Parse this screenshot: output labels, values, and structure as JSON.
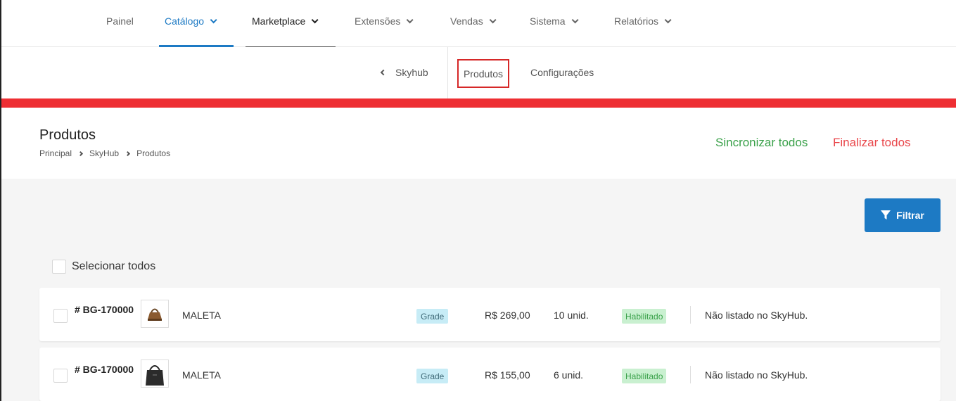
{
  "topnav": {
    "items": [
      {
        "label": "Painel"
      },
      {
        "label": "Catálogo"
      },
      {
        "label": "Marketplace"
      },
      {
        "label": "Extensões"
      },
      {
        "label": "Vendas"
      },
      {
        "label": "Sistema"
      },
      {
        "label": "Relatórios"
      }
    ]
  },
  "subnav": {
    "back_label": "Skyhub",
    "tabs": [
      {
        "label": "Produtos"
      },
      {
        "label": "Configurações"
      }
    ]
  },
  "header": {
    "title": "Produtos",
    "breadcrumb": [
      "Principal",
      "SkyHub",
      "Produtos"
    ],
    "sync_all": "Sincronizar todos",
    "finish_all": "Finalizar todos"
  },
  "toolbar": {
    "filter_label": "Filtrar",
    "select_all_label": "Selecionar todos"
  },
  "products": [
    {
      "sku": "# BG-170000",
      "name": "MALETA",
      "type": "Grade",
      "price": "R$ 269,00",
      "stock": "10 unid.",
      "status": "Habilitado",
      "listing": "Não listado no SkyHub."
    },
    {
      "sku": "# BG-170000",
      "name": "MALETA",
      "type": "Grade",
      "price": "R$ 155,00",
      "stock": "6 unid.",
      "status": "Habilitado",
      "listing": "Não listado no SkyHub."
    }
  ],
  "colors": {
    "accent": "#1d7ac4",
    "brand_bar": "#ee2e33",
    "success": "#3aa14a",
    "danger": "#e9464a"
  },
  "icons": {
    "filter": "funnel-icon",
    "dropdown": "chevron-down-icon",
    "back": "chevron-left-icon",
    "breadcrumb_sep": "chevron-right-icon"
  }
}
